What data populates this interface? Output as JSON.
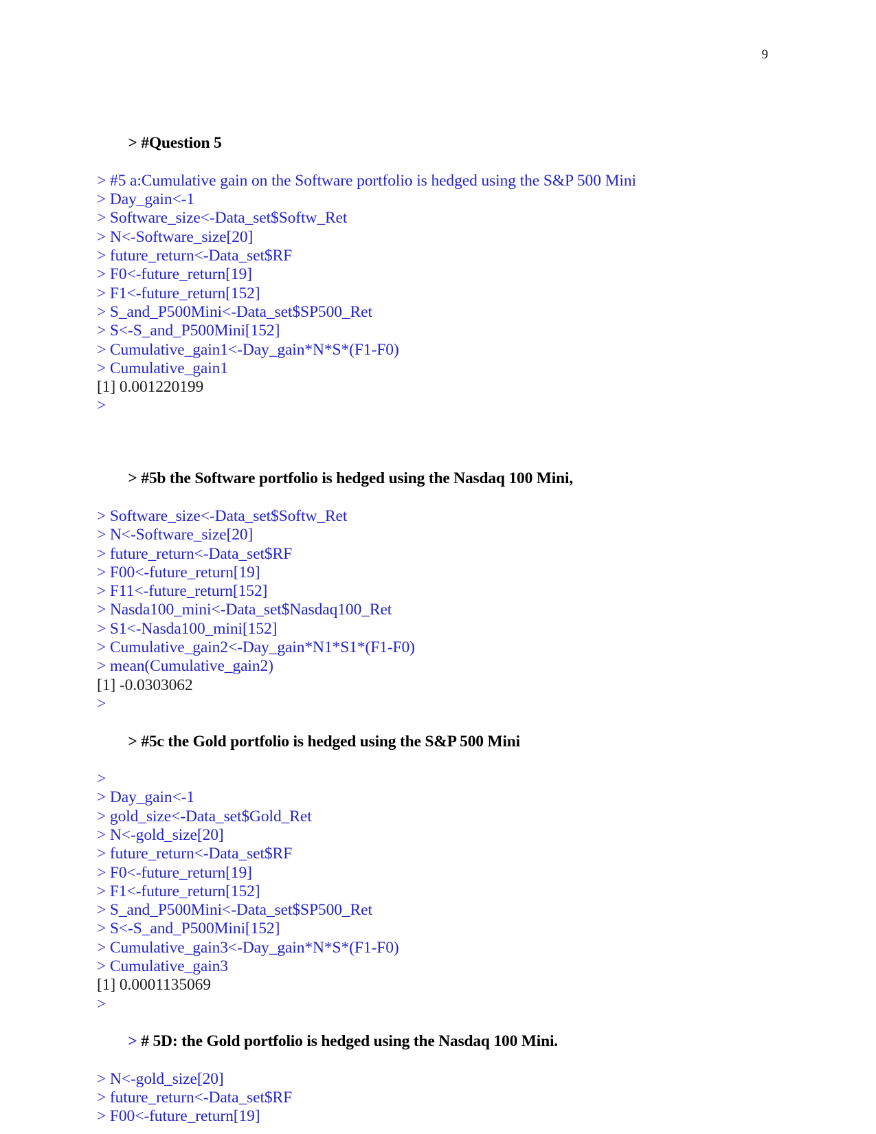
{
  "page": {
    "number": "9",
    "colors": {
      "command_blue": "#2323c8",
      "output_black": "#1a1a1a",
      "header_black": "#000000",
      "background": "#ffffff"
    }
  },
  "transcript": {
    "blocks": [
      {
        "id": "question-5",
        "lines": [
          {
            "type": "header",
            "text": "> #Question 5"
          },
          {
            "type": "cmd",
            "text": "> #5 a:Cumulative gain on the Software portfolio is hedged using the S&P 500 Mini"
          },
          {
            "type": "cmd",
            "text": "> Day_gain<-1"
          },
          {
            "type": "cmd",
            "text": "> Software_size<-Data_set$Softw_Ret"
          },
          {
            "type": "cmd",
            "text": "> N<-Software_size[20]"
          },
          {
            "type": "cmd",
            "text": "> future_return<-Data_set$RF"
          },
          {
            "type": "cmd",
            "text": "> F0<-future_return[19]"
          },
          {
            "type": "cmd",
            "text": "> F1<-future_return[152]"
          },
          {
            "type": "cmd",
            "text": "> S_and_P500Mini<-Data_set$SP500_Ret"
          },
          {
            "type": "cmd",
            "text": "> S<-S_and_P500Mini[152]"
          },
          {
            "type": "cmd",
            "text": "> Cumulative_gain1<-Day_gain*N*S*(F1-F0)"
          },
          {
            "type": "cmd",
            "text": "> Cumulative_gain1"
          },
          {
            "type": "out",
            "text": "[1] 0.001220199"
          },
          {
            "type": "cmd",
            "text": ">"
          },
          {
            "type": "spacer",
            "text": ""
          }
        ]
      },
      {
        "id": "question-5b",
        "lines": [
          {
            "type": "header",
            "text": "> #5b the Software portfolio is hedged using the Nasdaq 100 Mini,"
          },
          {
            "type": "cmd",
            "text": "> Software_size<-Data_set$Softw_Ret"
          },
          {
            "type": "cmd",
            "text": "> N<-Software_size[20]"
          },
          {
            "type": "cmd",
            "text": "> future_return<-Data_set$RF"
          },
          {
            "type": "cmd",
            "text": "> F00<-future_return[19]"
          },
          {
            "type": "cmd",
            "text": "> F11<-future_return[152]"
          },
          {
            "type": "cmd",
            "text": "> Nasda100_mini<-Data_set$Nasdaq100_Ret"
          },
          {
            "type": "cmd",
            "text": "> S1<-Nasda100_mini[152]"
          },
          {
            "type": "cmd",
            "text": "> Cumulative_gain2<-Day_gain*N1*S1*(F1-F0)"
          },
          {
            "type": "cmd",
            "text": "> mean(Cumulative_gain2)"
          },
          {
            "type": "out",
            "text": "[1] -0.0303062"
          },
          {
            "type": "cmd",
            "text": ">"
          }
        ]
      },
      {
        "id": "question-5c",
        "lines": [
          {
            "type": "header",
            "text": "> #5c the Gold portfolio is hedged using the S&P 500 Mini"
          },
          {
            "type": "cmd",
            "text": ">"
          },
          {
            "type": "cmd",
            "text": "> Day_gain<-1"
          },
          {
            "type": "cmd",
            "text": "> gold_size<-Data_set$Gold_Ret"
          },
          {
            "type": "cmd",
            "text": "> N<-gold_size[20]"
          },
          {
            "type": "cmd",
            "text": "> future_return<-Data_set$RF"
          },
          {
            "type": "cmd",
            "text": "> F0<-future_return[19]"
          },
          {
            "type": "cmd",
            "text": "> F1<-future_return[152]"
          },
          {
            "type": "cmd",
            "text": "> S_and_P500Mini<-Data_set$SP500_Ret"
          },
          {
            "type": "cmd",
            "text": "> S<-S_and_P500Mini[152]"
          },
          {
            "type": "cmd",
            "text": "> Cumulative_gain3<-Day_gain*N*S*(F1-F0)"
          },
          {
            "type": "cmd",
            "text": "> Cumulative_gain3"
          },
          {
            "type": "out",
            "text": "[1] 0.0001135069"
          },
          {
            "type": "cmd",
            "text": ">"
          }
        ]
      },
      {
        "id": "question-5d",
        "lines": [
          {
            "type": "header-split",
            "prompt": "> ",
            "text": "# 5D: the Gold portfolio is hedged using the Nasdaq 100 Mini."
          },
          {
            "type": "cmd",
            "text": "> N<-gold_size[20]"
          },
          {
            "type": "cmd",
            "text": "> future_return<-Data_set$RF"
          },
          {
            "type": "cmd",
            "text": "> F00<-future_return[19]"
          }
        ]
      }
    ]
  }
}
